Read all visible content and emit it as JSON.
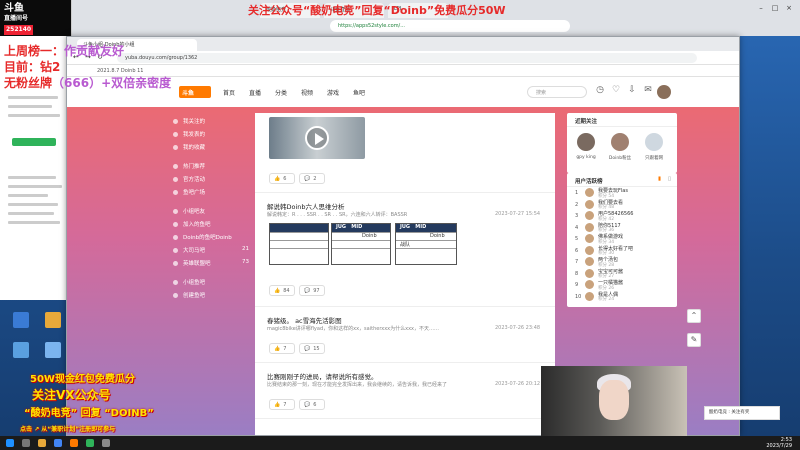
{
  "overlay": {
    "top_banner": "关注公众号“酸奶电竞”回复“Doinb”免费瓜分50W",
    "logo_title": "斗鱼",
    "logo_sub": "直播间号",
    "logo_num": "252140",
    "line1": "上周榜一：",
    "line1b": "作贡献友好",
    "line2": "目前：钻2",
    "line3": "无粉丝牌",
    "line3b": "（666）+双倍亲密度",
    "promo1": "50W现金红包免费瓜分",
    "promo2": "关注VX公众号",
    "promo3": "“酸奶电竞” 回复 “DOINB”",
    "promo4": "点击 ↗ 从“兼职计划”注册即可参与"
  },
  "bg_browser": {
    "tabs": [
      "酸奶电竞",
      "斗鱼直播",
      "LPL"
    ],
    "url": "https://apps52style.com/..."
  },
  "browser": {
    "tab_label": "斗鱼小组-Doinb的小组",
    "url": "yuba.douyu.com/group/1362",
    "bookmarks": "2021.8.7    Doinb 11"
  },
  "site": {
    "logo": "斗鱼",
    "nav": [
      "首页",
      "直播",
      "分类",
      "视频",
      "游戏",
      "鱼吧"
    ],
    "search_placeholder": "搜索",
    "nav_icons": [
      "history-icon",
      "follow-icon",
      "download-icon",
      "message-icon"
    ]
  },
  "side_menu": [
    {
      "label": "我关注的",
      "count": ""
    },
    {
      "label": "我发表的",
      "count": ""
    },
    {
      "label": "我的收藏",
      "count": ""
    },
    {
      "label": "",
      "count": ""
    },
    {
      "label": "热门推荐",
      "count": ""
    },
    {
      "label": "官方活动",
      "count": ""
    },
    {
      "label": "鱼吧广场",
      "count": ""
    },
    {
      "label": "",
      "count": ""
    },
    {
      "label": "小组吧友",
      "count": ""
    },
    {
      "label": "加入的鱼吧",
      "count": ""
    },
    {
      "label": "Doinb的鱼吧Doinb",
      "count": ""
    },
    {
      "label": "大司马吧",
      "count": "21"
    },
    {
      "label": "英雄联盟吧",
      "count": "73"
    },
    {
      "label": "",
      "count": ""
    },
    {
      "label": "小组鱼吧",
      "count": ""
    },
    {
      "label": "创建鱼吧",
      "count": ""
    }
  ],
  "feed": {
    "posts": [
      {
        "title": "",
        "sub": "",
        "meta": "",
        "likes": "6",
        "comments": "2"
      },
      {
        "title": "解说韩Doinb六人思维分析",
        "sub": "解说韩定：R . . . SSR . . SR . . SR，六连和六人转评：BASSR",
        "meta": "2023-07-27 15:54",
        "likes": "84",
        "comments": "97"
      },
      {
        "title": "春猪级。 ac雪海先活影图",
        "sub": "magic8bike讲评哪flyad，你和这样的xx，saitherxxx为什么xxx，不天……",
        "meta": "2023-07-26 23:48",
        "likes": "7",
        "comments": "15"
      },
      {
        "title": "比赛刚刚子的进局，请帮说所有感觉。",
        "sub": "比赛结束的那一刻，现在才能完全发挥出来，我会继续的，请告诉我，我已经来了",
        "meta": "2023-07-26 20:12",
        "likes": "7",
        "comments": "6"
      }
    ],
    "table_headers": [
      "JUG",
      "MID"
    ],
    "table_cells": [
      "Doinb",
      "Doinb",
      "战队"
    ]
  },
  "right": {
    "top_title": "近期关注",
    "top_users": [
      "gpy king",
      "Doinb粉丝",
      "只跟着网"
    ],
    "rank_title": "用户活跃榜",
    "rank": [
      {
        "rk": "1",
        "name": "我要去玩Flas",
        "score": "积分 54"
      },
      {
        "rk": "2",
        "name": "我们要去看",
        "score": "积分 48"
      },
      {
        "rk": "3",
        "name": "用户58426566",
        "score": "积分 42"
      },
      {
        "rk": "4",
        "name": "陪你5117",
        "score": "积分 36"
      },
      {
        "rk": "5",
        "name": "佛系做游戏",
        "score": "积分 34"
      },
      {
        "rk": "6",
        "name": "长得太好看了吧",
        "score": "积分 30"
      },
      {
        "rk": "7",
        "name": "两个汤包",
        "score": "积分 28"
      },
      {
        "rk": "8",
        "name": "宝宝可可酱",
        "score": "积分 27"
      },
      {
        "rk": "9",
        "name": "一只橘猫酱",
        "score": "积分 26"
      },
      {
        "rk": "10",
        "name": "我是人偶",
        "score": "积分 24"
      }
    ]
  },
  "toast": "酸奶电竞 : 关注有奖",
  "taskbar": {
    "time": "2:53",
    "date": "2023/7/29"
  },
  "colors": {
    "accent": "#ff7a00",
    "banner_red": "#e62a2a",
    "promo_yellow": "#ffe600"
  }
}
